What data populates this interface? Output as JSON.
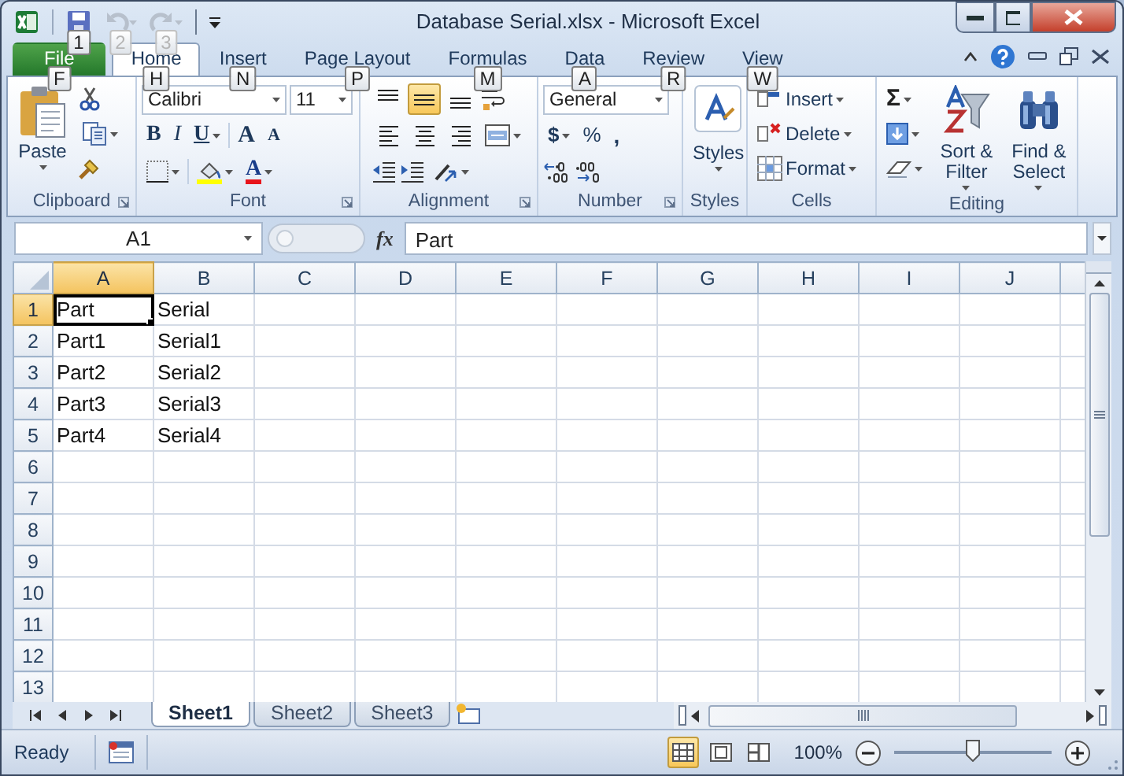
{
  "window": {
    "title": "Database Serial.xlsx  -  Microsoft Excel"
  },
  "quick_access": [
    {
      "kind": "save",
      "keytip": "1",
      "disabled": false
    },
    {
      "kind": "undo",
      "keytip": "2",
      "disabled": true
    },
    {
      "kind": "redo",
      "keytip": "3",
      "disabled": true
    }
  ],
  "tabs": [
    {
      "label": "File",
      "keytip": "F",
      "kind": "file",
      "selected": false
    },
    {
      "label": "Home",
      "keytip": "H",
      "kind": "tab",
      "selected": true
    },
    {
      "label": "Insert",
      "keytip": "N",
      "kind": "tab",
      "selected": false
    },
    {
      "label": "Page Layout",
      "keytip": "P",
      "kind": "tab",
      "selected": false
    },
    {
      "label": "Formulas",
      "keytip": "M",
      "kind": "tab",
      "selected": false
    },
    {
      "label": "Data",
      "keytip": "A",
      "kind": "tab",
      "selected": false
    },
    {
      "label": "Review",
      "keytip": "R",
      "kind": "tab",
      "selected": false
    },
    {
      "label": "View",
      "keytip": "W",
      "kind": "tab",
      "selected": false
    }
  ],
  "ribbon": {
    "clipboard": {
      "label": "Clipboard",
      "paste": "Paste"
    },
    "font": {
      "label": "Font",
      "name": "Calibri",
      "size": "11",
      "bold": "B",
      "italic": "I",
      "underline": "U",
      "grow": "A",
      "shrink": "A",
      "font_color_letter": "A"
    },
    "alignment": {
      "label": "Alignment",
      "buttons": [
        {
          "kind": "top",
          "selected": false
        },
        {
          "kind": "middle",
          "selected": true
        },
        {
          "kind": "bottom",
          "selected": false
        },
        {
          "kind": "left",
          "selected": false
        },
        {
          "kind": "center",
          "selected": false
        },
        {
          "kind": "right",
          "selected": false
        }
      ]
    },
    "number": {
      "label": "Number",
      "format": "General",
      "currency": "$",
      "percent": "%",
      "comma": ","
    },
    "styles": {
      "label": "Styles",
      "button": "Styles"
    },
    "cells": {
      "label": "Cells",
      "buttons": [
        {
          "kind": "insert",
          "label": "Insert"
        },
        {
          "kind": "delete",
          "label": "Delete"
        },
        {
          "kind": "format",
          "label": "Format"
        }
      ]
    },
    "editing": {
      "label": "Editing",
      "autosum": "Σ",
      "sort": "Sort & Filter",
      "find": "Find & Select"
    }
  },
  "formula_bar": {
    "name_box": "A1",
    "function_label": "fx",
    "value": "Part"
  },
  "columns": [
    {
      "label": "A",
      "selected": true
    },
    {
      "label": "B",
      "selected": false
    },
    {
      "label": "C",
      "selected": false
    },
    {
      "label": "D",
      "selected": false
    },
    {
      "label": "E",
      "selected": false
    },
    {
      "label": "F",
      "selected": false
    },
    {
      "label": "G",
      "selected": false
    },
    {
      "label": "H",
      "selected": false
    },
    {
      "label": "I",
      "selected": false
    },
    {
      "label": "J",
      "selected": false
    }
  ],
  "rows": [
    {
      "header": "1",
      "selected": true,
      "cells": [
        {
          "text": "Part",
          "selected": true
        },
        {
          "text": "Serial",
          "selected": false
        }
      ]
    },
    {
      "header": "2",
      "selected": false,
      "cells": [
        {
          "text": "Part1",
          "selected": false
        },
        {
          "text": "Serial1",
          "selected": false
        }
      ]
    },
    {
      "header": "3",
      "selected": false,
      "cells": [
        {
          "text": "Part2",
          "selected": false
        },
        {
          "text": "Serial2",
          "selected": false
        }
      ]
    },
    {
      "header": "4",
      "selected": false,
      "cells": [
        {
          "text": "Part3",
          "selected": false
        },
        {
          "text": "Serial3",
          "selected": false
        }
      ]
    },
    {
      "header": "5",
      "selected": false,
      "cells": [
        {
          "text": "Part4",
          "selected": false
        },
        {
          "text": "Serial4",
          "selected": false
        }
      ]
    },
    {
      "header": "6",
      "selected": false
    },
    {
      "header": "7",
      "selected": false
    },
    {
      "header": "8",
      "selected": false
    },
    {
      "header": "9",
      "selected": false
    },
    {
      "header": "10",
      "selected": false
    },
    {
      "header": "11",
      "selected": false
    },
    {
      "header": "12",
      "selected": false
    },
    {
      "header": "13",
      "selected": false
    }
  ],
  "sheets": [
    {
      "label": "Sheet1",
      "selected": true
    },
    {
      "label": "Sheet2",
      "selected": false
    },
    {
      "label": "Sheet3",
      "selected": false
    }
  ],
  "status_bar": {
    "status": "Ready",
    "views": [
      {
        "kind": "normal",
        "selected": true
      },
      {
        "kind": "page_layout",
        "selected": false
      },
      {
        "kind": "page_break",
        "selected": false
      }
    ],
    "zoom": "100%",
    "zoom_slider": {
      "level": 0.5
    }
  }
}
